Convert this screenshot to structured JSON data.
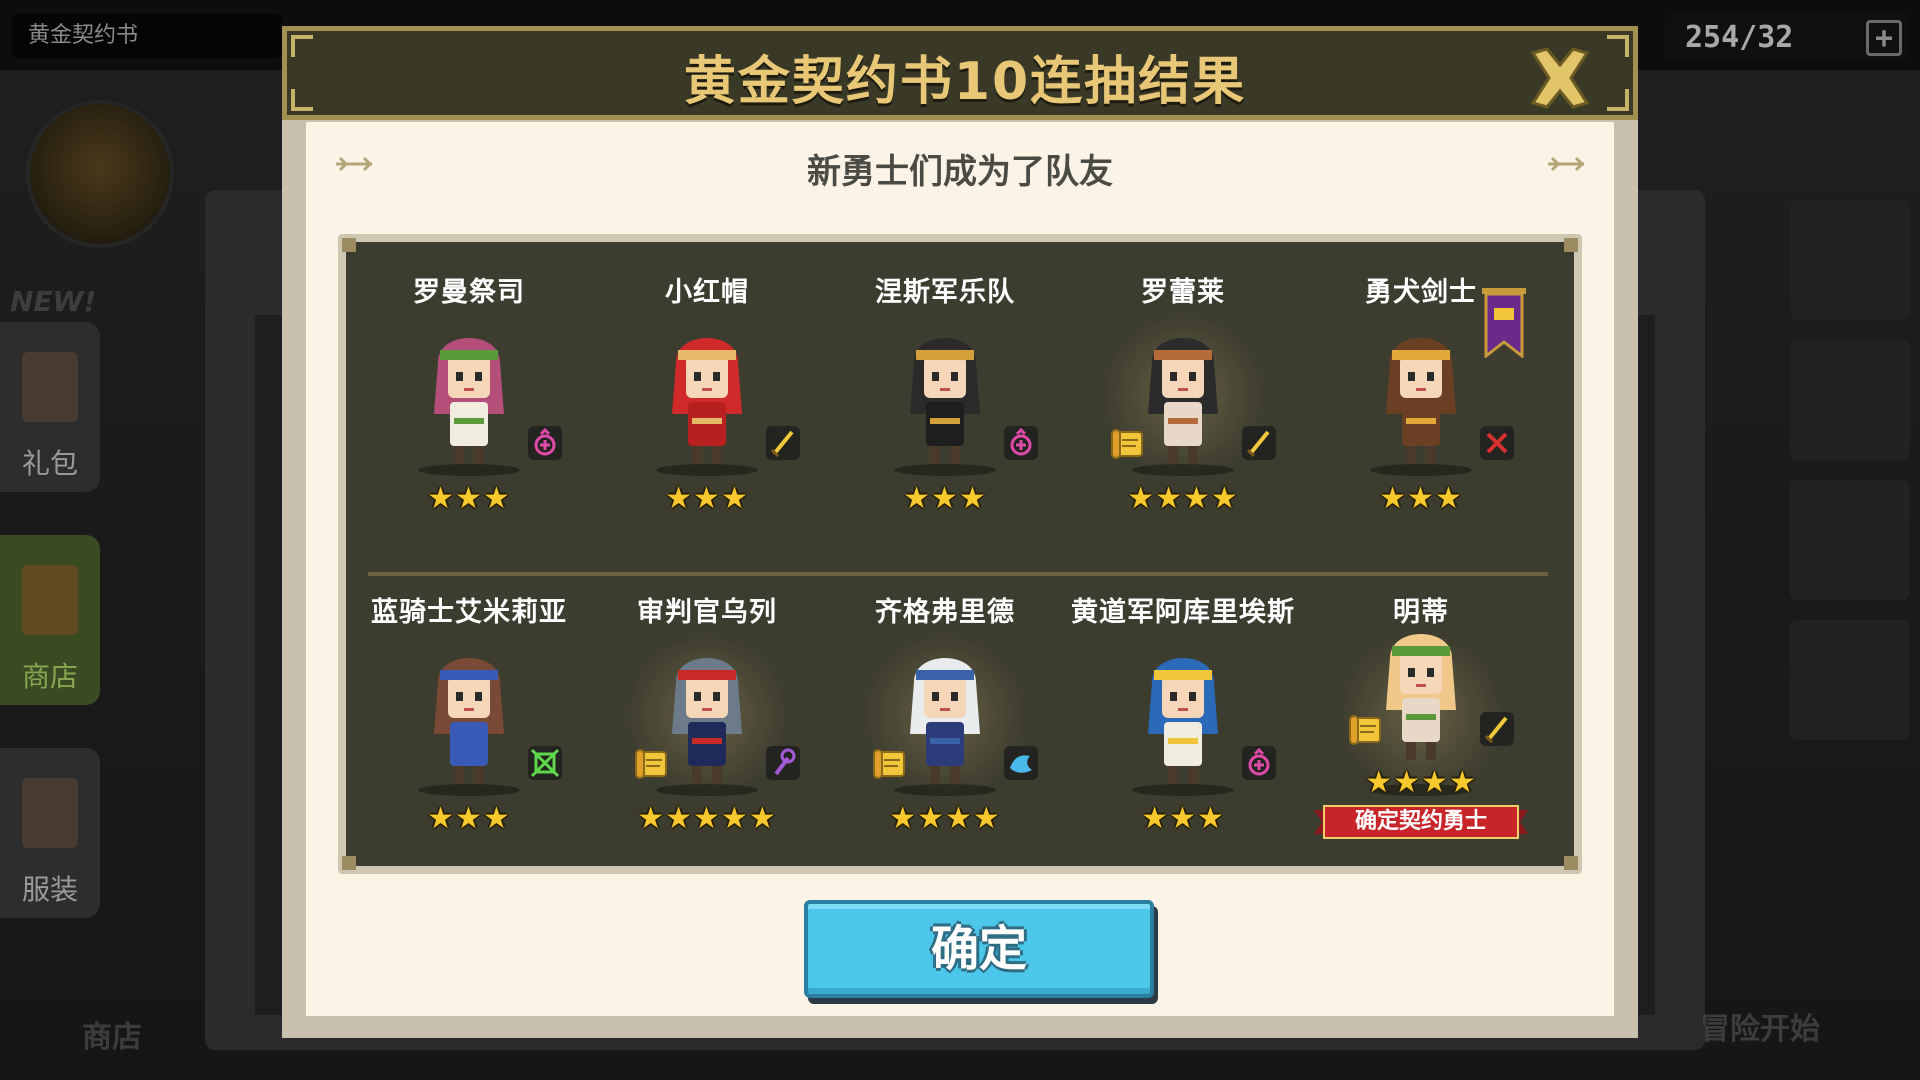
{
  "background": {
    "top_left_text": "黄金契约书",
    "gold_counter": "254/32",
    "plus_label": "+",
    "left_menu": [
      {
        "label": "礼包",
        "active": false
      },
      {
        "label": "商店",
        "active": true
      },
      {
        "label": "服装",
        "active": false
      }
    ],
    "new_tag": "NEW!",
    "bottom_left_text": "商店",
    "bottom_right_text": "冒险开始"
  },
  "modal": {
    "title": "黄金契约书10连抽结果",
    "subtitle": "新勇士们成为了队友",
    "close_icon": "close-x-icon",
    "confirm_button": "确定"
  },
  "heroes": [
    {
      "name": "罗曼祭司",
      "stars": "★★★",
      "role": "healer",
      "has_scroll": false,
      "has_banner": false,
      "colors": {
        "hair": "#b44f7a",
        "accent": "#5a9a3a",
        "body": "#f1ece0"
      }
    },
    {
      "name": "小红帽",
      "stars": "★★★",
      "role": "sword",
      "has_scroll": false,
      "has_banner": false,
      "colors": {
        "hair": "#d02a2a",
        "accent": "#e8b86a",
        "body": "#b81f1f"
      }
    },
    {
      "name": "涅斯军乐队",
      "stars": "★★★",
      "role": "healer",
      "has_scroll": false,
      "has_banner": false,
      "colors": {
        "hair": "#2a2a2a",
        "accent": "#d4a03a",
        "body": "#1e1e1e"
      }
    },
    {
      "name": "罗蕾莱",
      "stars": "★★★★",
      "role": "sword",
      "has_scroll": true,
      "has_banner": false,
      "colors": {
        "hair": "#2b2b2b",
        "accent": "#b56a3a",
        "body": "#e8d8c8"
      }
    },
    {
      "name": "勇犬剑士",
      "stars": "★★★",
      "role": "cross",
      "has_scroll": false,
      "has_banner": true,
      "colors": {
        "hair": "#6b3f24",
        "accent": "#e0a93a",
        "body": "#6b3f24"
      }
    },
    {
      "name": "蓝骑士艾米莉亚",
      "stars": "★★★",
      "role": "crosshair",
      "has_scroll": false,
      "has_banner": false,
      "colors": {
        "hair": "#7a4a36",
        "accent": "#3a5ab8",
        "body": "#3a5ab8"
      }
    },
    {
      "name": "审判官乌列",
      "stars": "★★★★★",
      "role": "staff",
      "has_scroll": true,
      "has_banner": false,
      "colors": {
        "hair": "#6c7a8a",
        "accent": "#c82a2a",
        "body": "#1f2a5a"
      }
    },
    {
      "name": "齐格弗里德",
      "stars": "★★★★",
      "role": "wave",
      "has_scroll": true,
      "has_banner": false,
      "colors": {
        "hair": "#e8ecec",
        "accent": "#3a62a8",
        "body": "#2c3c7a"
      }
    },
    {
      "name": "黄道军阿库里埃斯",
      "stars": "★★★",
      "role": "healer",
      "has_scroll": false,
      "has_banner": false,
      "colors": {
        "hair": "#2a6ab8",
        "accent": "#f2c63a",
        "body": "#f1ece0"
      }
    },
    {
      "name": "明蒂",
      "stars": "★★★★",
      "role": "sword",
      "has_scroll": true,
      "has_banner": false,
      "confirm_label": "确定契约勇士",
      "colors": {
        "hair": "#f0c88a",
        "accent": "#5a9a3a",
        "body": "#e8d8c8"
      }
    }
  ],
  "colors": {
    "header_bg": "#3a3827",
    "header_title": "#e8c877",
    "panel_bg": "#fbf3e6",
    "grid_bg": "#3c3c2f",
    "star": "#f7c92c",
    "confirm_button": "#4cc7ea",
    "ribbon": "#c8252b"
  }
}
